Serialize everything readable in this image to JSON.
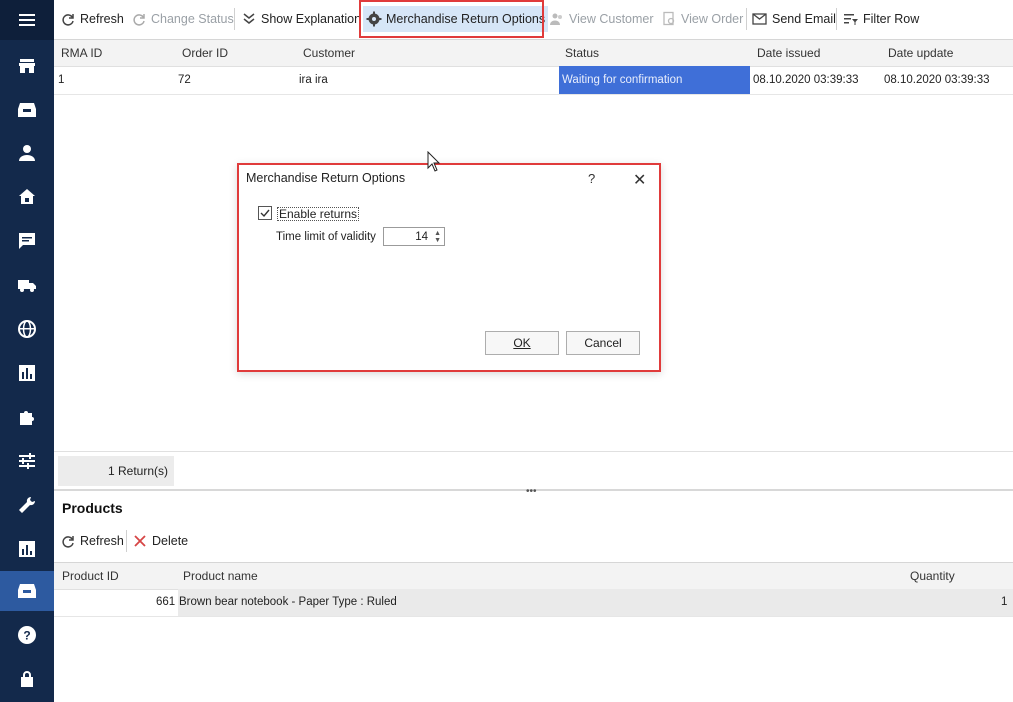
{
  "toolbar": {
    "refresh": "Refresh",
    "change_status": "Change Status",
    "show_explanation": "Show Explanation",
    "merchandise_return_options": "Merchandise Return Options",
    "view_customer": "View Customer",
    "view_order": "View Order",
    "send_email": "Send Email",
    "filter_row": "Filter Row"
  },
  "returns_grid": {
    "columns": [
      "RMA ID",
      "Order ID",
      "Customer",
      "Status",
      "Date issued",
      "Date update"
    ],
    "rows": [
      {
        "rma_id": "1",
        "order_id": "72",
        "customer": "ira ira",
        "status": "Waiting for confirmation",
        "date_issued": "08.10.2020 03:39:33",
        "date_update": "08.10.2020 03:39:33"
      }
    ],
    "footer": "1 Return(s)"
  },
  "products": {
    "title": "Products",
    "refresh": "Refresh",
    "delete": "Delete",
    "columns": [
      "Product ID",
      "Product name",
      "Quantity"
    ],
    "rows": [
      {
        "product_id": "661",
        "product_name": "Brown bear notebook - Paper Type : Ruled",
        "quantity": "1"
      }
    ]
  },
  "dialog": {
    "title": "Merchandise Return Options",
    "help": "?",
    "close": "✕",
    "enable_returns_label": "Enable returns",
    "enable_returns_checked": true,
    "time_limit_label": "Time limit of validity",
    "time_limit_value": "14",
    "ok": "OK",
    "cancel": "Cancel"
  },
  "sidebar": {
    "icons": [
      "menu-icon",
      "store-icon",
      "inbox-icon",
      "user-icon",
      "shop-icon",
      "chat-icon",
      "truck-icon",
      "globe-icon",
      "chart-icon",
      "puzzle-icon",
      "sliders-icon",
      "wrench-icon",
      "stats-icon",
      "returns-icon",
      "help-icon",
      "lock-icon"
    ],
    "active": "returns-icon"
  },
  "colors": {
    "sidebar": "#13294b",
    "sidebar_active": "#2d5aa0",
    "status_highlight": "#3f6fd8",
    "highlight_border": "#e03b3b"
  }
}
